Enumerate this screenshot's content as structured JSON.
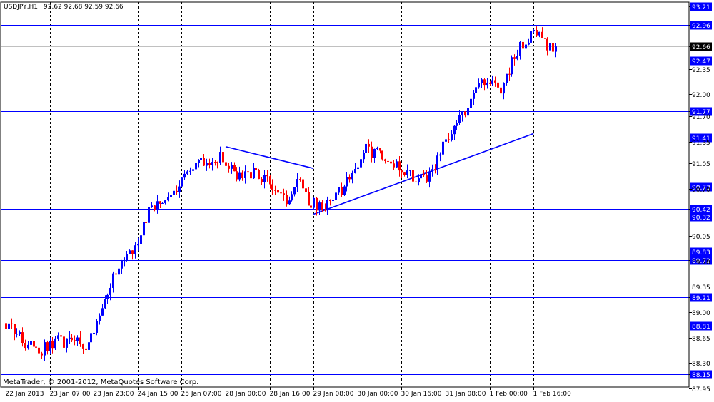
{
  "header": {
    "symbol": "USDJPY,H1",
    "ohlc_values": "92.62 92.68 92.59 92.66"
  },
  "footer": {
    "copyright": "MetaTrader, © 2001-2012, MetaQuotes Software Corp."
  },
  "colors": {
    "background": "#ffffff",
    "frame": "#000000",
    "bull_candle": "#0000ff",
    "bear_candle": "#ff0000",
    "level_line": "#0000ff",
    "level_tag_bg": "#0000ff",
    "level_tag_text": "#ffffff",
    "current_price_tag_bg": "#000000",
    "grid_vertical": "#000000"
  },
  "chart_data": {
    "type": "candlestick",
    "title": "USDJPY,H1",
    "ylim": [
      87.97,
      93.27
    ],
    "grid": "vertical-dashed",
    "y_ticks": [
      "93.21",
      "92.96",
      "92.66",
      "92.47",
      "92.35",
      "92.00",
      "91.77",
      "91.70",
      "91.41",
      "91.35",
      "91.05",
      "90.73",
      "90.70",
      "90.42",
      "90.32",
      "90.05",
      "89.83",
      "89.72",
      "89.70",
      "89.35",
      "89.21",
      "89.00",
      "88.81",
      "88.65",
      "88.30",
      "88.15",
      "87.95"
    ],
    "x_ticks": [
      "22 Jan 2013",
      "23 Jan 07:00",
      "23 Jan 23:00",
      "24 Jan 15:00",
      "25 Jan 07:00",
      "28 Jan 00:00",
      "28 Jan 16:00",
      "29 Jan 08:00",
      "30 Jan 00:00",
      "30 Jan 16:00",
      "31 Jan 08:00",
      "1 Feb 00:00",
      "1 Feb 16:00"
    ],
    "horizontal_levels": [
      "92.96",
      "92.47",
      "91.77",
      "91.41",
      "90.73",
      "90.42",
      "90.32",
      "89.83",
      "89.72",
      "89.21",
      "88.81",
      "88.15"
    ],
    "current_price": "92.66",
    "trend_lines": [
      {
        "start": [
          "28 Jan 00:00",
          91.28
        ],
        "end": [
          "29 Jan 08:00",
          90.98
        ]
      },
      {
        "start": [
          "29 Jan 08:00",
          90.35
        ],
        "end": [
          "1 Feb 16:00",
          91.46
        ]
      }
    ],
    "close_path": [
      [
        0,
        88.85
      ],
      [
        6,
        88.62
      ],
      [
        12,
        88.45
      ],
      [
        18,
        88.62
      ],
      [
        24,
        88.58
      ],
      [
        30,
        88.55
      ],
      [
        36,
        89.22
      ],
      [
        42,
        89.7
      ],
      [
        48,
        89.95
      ],
      [
        52,
        90.4
      ],
      [
        56,
        90.55
      ],
      [
        60,
        90.6
      ],
      [
        63,
        90.7
      ],
      [
        66,
        91.0
      ],
      [
        70,
        91.1
      ],
      [
        74,
        91.05
      ],
      [
        78,
        91.15
      ],
      [
        82,
        90.95
      ],
      [
        86,
        90.85
      ],
      [
        90,
        90.92
      ],
      [
        94,
        90.85
      ],
      [
        98,
        90.7
      ],
      [
        102,
        90.55
      ],
      [
        106,
        90.85
      ],
      [
        110,
        90.55
      ],
      [
        114,
        90.45
      ],
      [
        118,
        90.5
      ],
      [
        122,
        90.7
      ],
      [
        126,
        90.9
      ],
      [
        130,
        91.25
      ],
      [
        134,
        91.2
      ],
      [
        138,
        91.1
      ],
      [
        142,
        91.05
      ],
      [
        146,
        90.92
      ],
      [
        150,
        90.8
      ],
      [
        154,
        90.88
      ],
      [
        158,
        91.2
      ],
      [
        162,
        91.5
      ],
      [
        165,
        91.75
      ],
      [
        168,
        91.8
      ],
      [
        172,
        92.2
      ],
      [
        176,
        92.15
      ],
      [
        180,
        92.05
      ],
      [
        184,
        92.45
      ],
      [
        188,
        92.7
      ],
      [
        192,
        92.85
      ],
      [
        196,
        92.7
      ],
      [
        200,
        92.66
      ]
    ]
  }
}
